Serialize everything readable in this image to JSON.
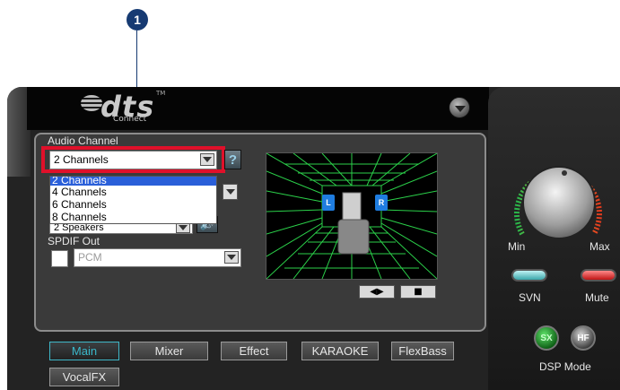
{
  "callout": {
    "number": "1"
  },
  "brand": {
    "logo_text": "dts",
    "sub_text": "Connect",
    "tm": "TM"
  },
  "audio_channel": {
    "label": "Audio Channel",
    "selected": "2 Channels",
    "help": "?",
    "options": [
      "2 Channels",
      "4 Channels",
      "6 Channels",
      "8 Channels"
    ]
  },
  "speakers": {
    "selected": "2 Speakers"
  },
  "spdif": {
    "label": "SPDIF Out",
    "selected": "PCM"
  },
  "room": {
    "left_label": "L",
    "right_label": "R"
  },
  "tabs": [
    "Main",
    "Mixer",
    "Effect",
    "KARAOKE",
    "FlexBass",
    "VocalFX"
  ],
  "volume": {
    "min_label": "Min",
    "max_label": "Max"
  },
  "controls": {
    "svn_label": "SVN",
    "mute_label": "Mute",
    "dsp_label": "DSP Mode",
    "sx_label": "SX",
    "hf_label": "HF"
  },
  "colors": {
    "highlight": "#e0102a",
    "grid": "#2bd14a",
    "active_tab": "#39b7c9",
    "callout": "#163a72"
  }
}
